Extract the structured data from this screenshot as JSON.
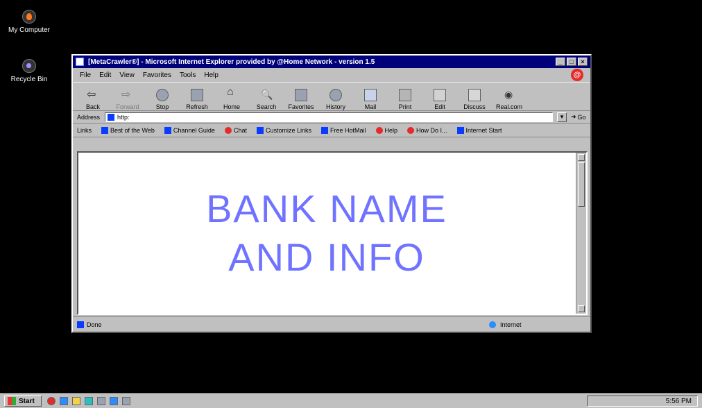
{
  "desktop": {
    "icons": [
      {
        "label": "My Computer"
      },
      {
        "label": "Recycle Bin"
      }
    ]
  },
  "window": {
    "title": "[MetaCrawler®] - Microsoft Internet Explorer provided by @Home Network - version 1.5",
    "menu": [
      "File",
      "Edit",
      "View",
      "Favorites",
      "Tools",
      "Help"
    ],
    "toolbar": [
      {
        "label": "Back",
        "icon": "back-arrow-icon"
      },
      {
        "label": "Forward",
        "icon": "forward-arrow-icon"
      },
      {
        "label": "Stop",
        "icon": "stop-icon"
      },
      {
        "label": "Refresh",
        "icon": "refresh-icon"
      },
      {
        "label": "Home",
        "icon": "home-icon"
      },
      {
        "label": "Search",
        "icon": "search-icon"
      },
      {
        "label": "Favorites",
        "icon": "favorites-icon"
      },
      {
        "label": "History",
        "icon": "history-icon"
      },
      {
        "label": "Mail",
        "icon": "mail-icon"
      },
      {
        "label": "Print",
        "icon": "print-icon"
      },
      {
        "label": "Edit",
        "icon": "edit-icon"
      },
      {
        "label": "Discuss",
        "icon": "discuss-icon"
      },
      {
        "label": "Real.com",
        "icon": "realcom-icon"
      }
    ],
    "address": {
      "label": "Address",
      "value": "http:"
    },
    "go_label": "Go",
    "links": {
      "label": "Links",
      "items": [
        {
          "label": "Best of the Web"
        },
        {
          "label": "Channel Guide"
        },
        {
          "label": "Chat"
        },
        {
          "label": "Customize Links"
        },
        {
          "label": "Free HotMail"
        },
        {
          "label": "Help"
        },
        {
          "label": "How Do I..."
        },
        {
          "label": "Internet Start"
        }
      ]
    },
    "content": {
      "line1": "BANK NAME",
      "line2": "AND INFO"
    },
    "status": {
      "left": "Done",
      "zone": "Internet"
    }
  },
  "taskbar": {
    "start_label": "Start",
    "time": "5:56 PM"
  }
}
